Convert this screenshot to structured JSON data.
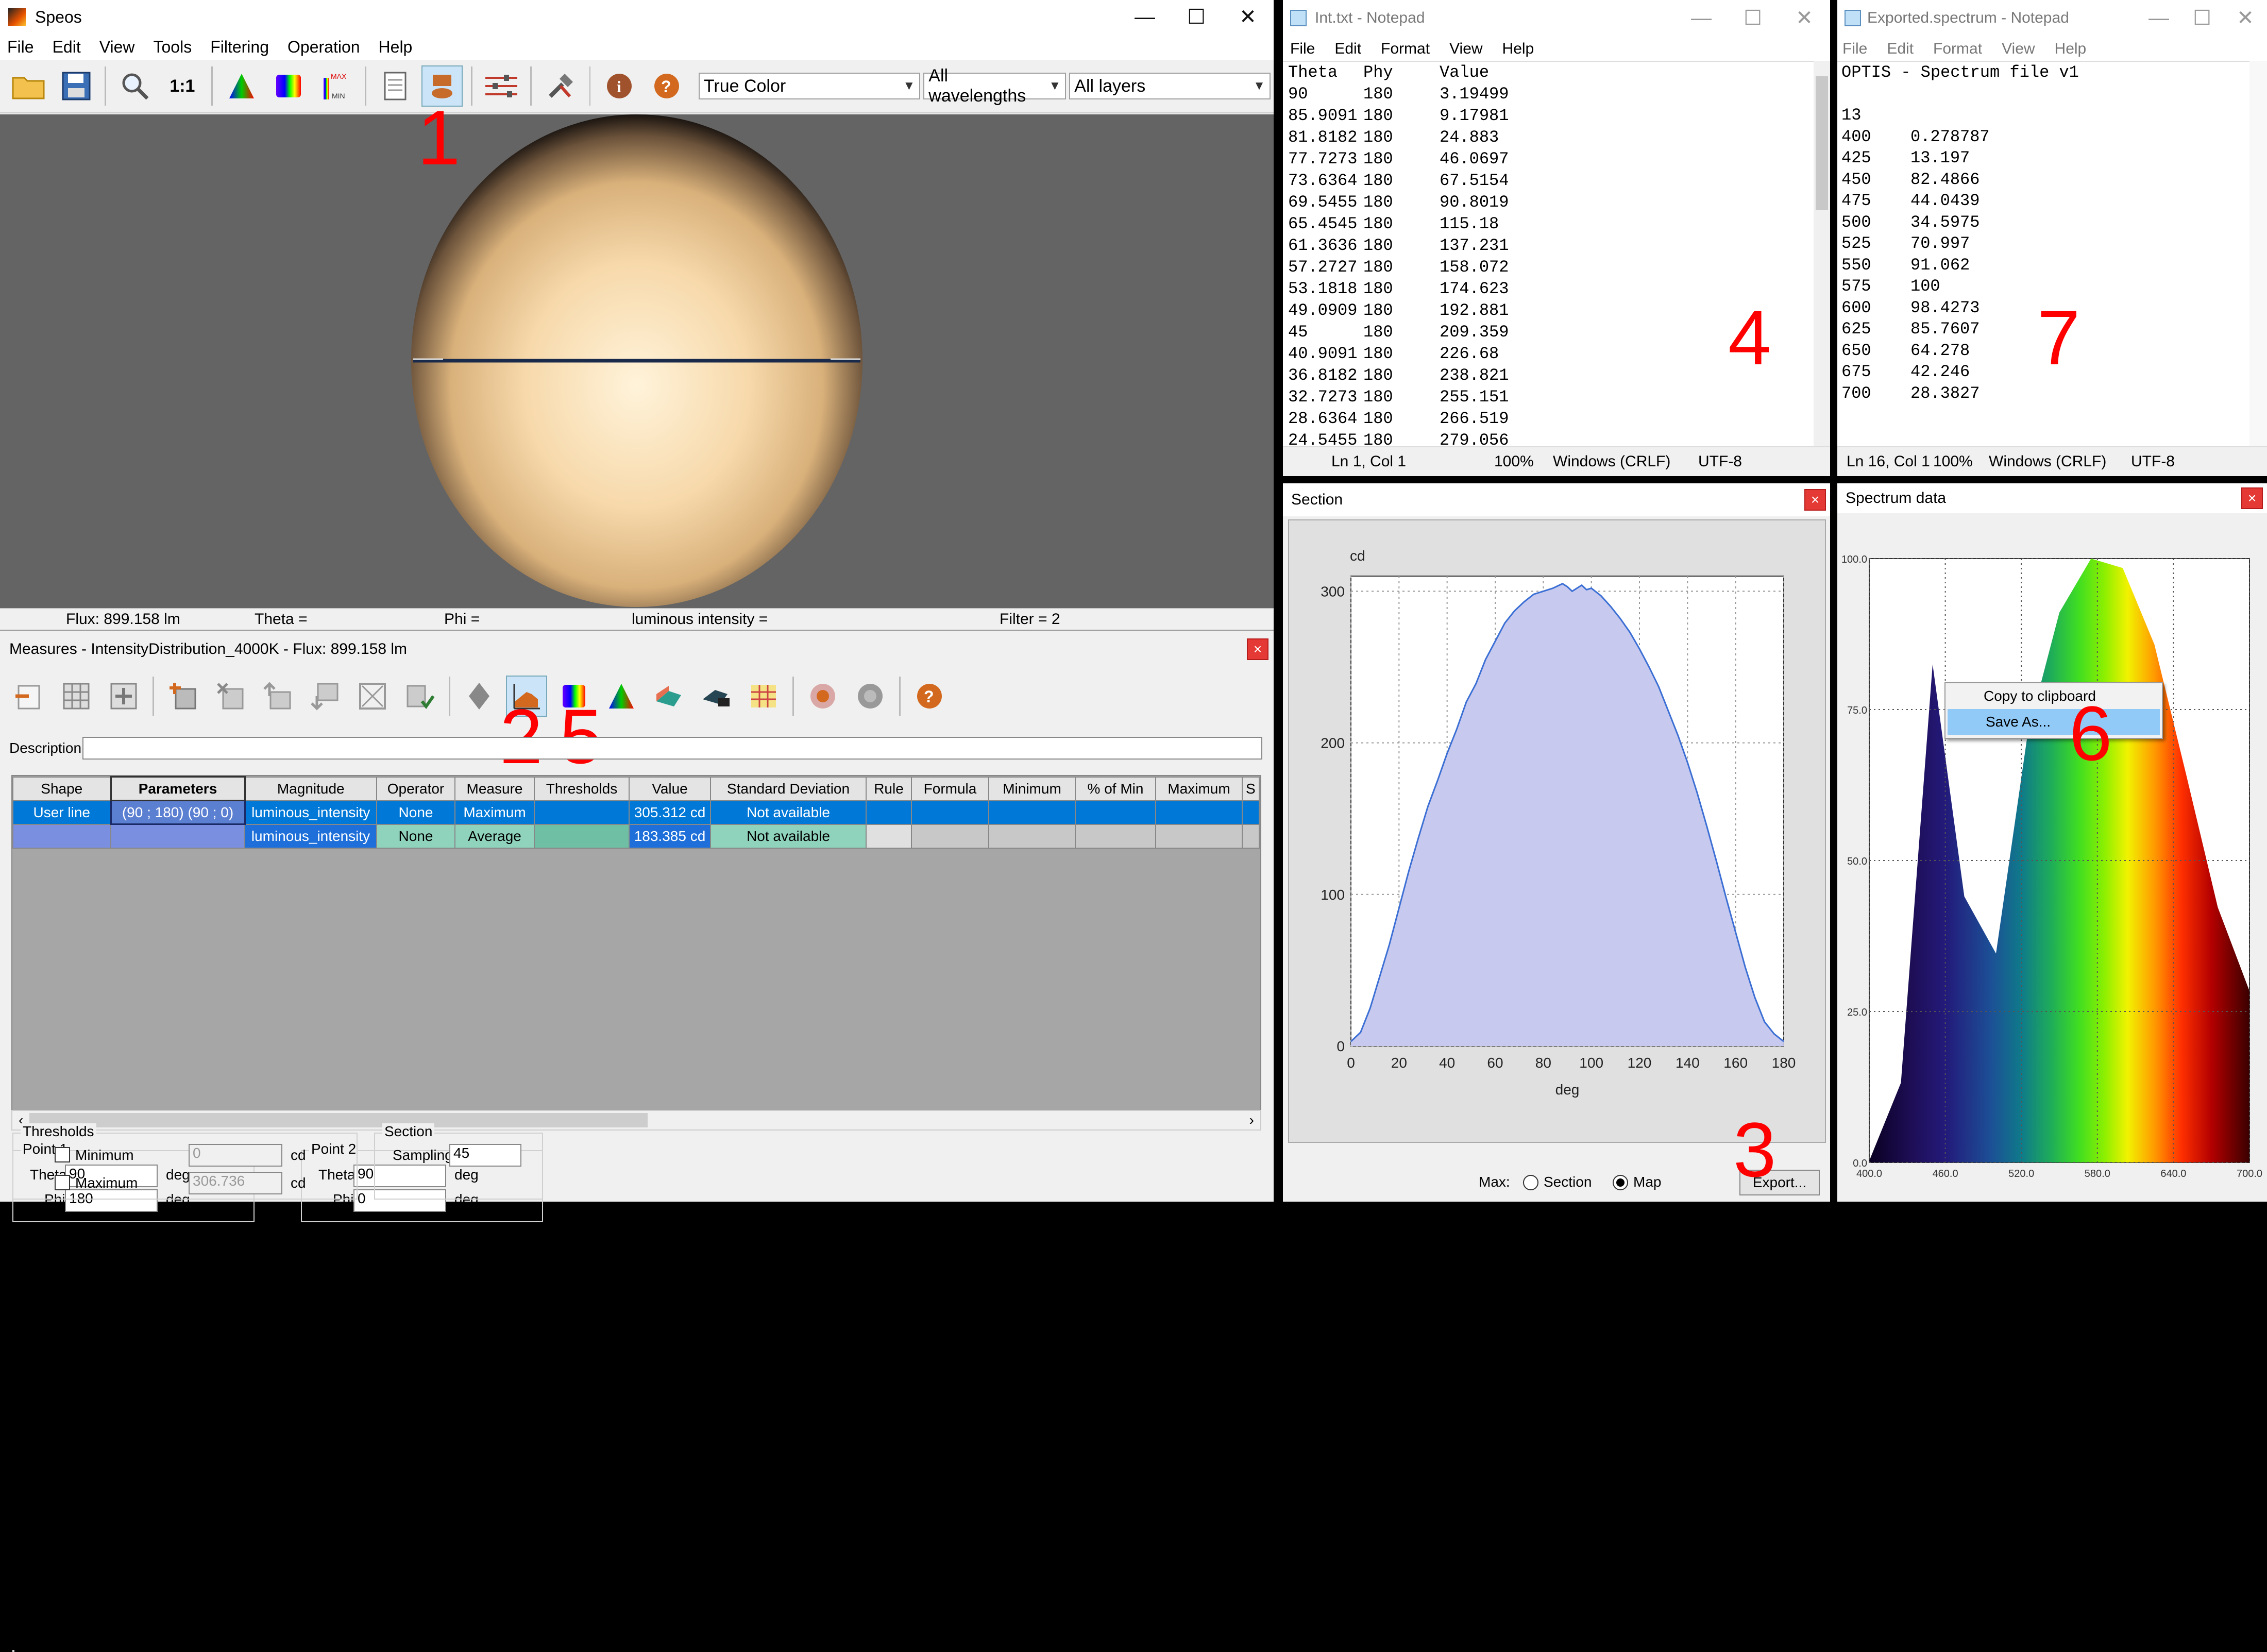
{
  "speos": {
    "title": "Speos",
    "menu": [
      "File",
      "Edit",
      "View",
      "Tools",
      "Filtering",
      "Operation",
      "Help"
    ],
    "toolbar_icons": [
      "open-icon",
      "save-icon",
      "zoom-icon",
      "actual-size-icon",
      "color-chart-icon",
      "spectrum-icon",
      "max-scale-icon",
      "report-icon",
      "section-view-icon",
      "parameters-icon",
      "tools-icon",
      "info-icon",
      "help-icon"
    ],
    "combo_color": "True Color",
    "combo_wavelengths": "All wavelengths",
    "combo_layers": "All layers",
    "status": {
      "flux": "Flux: 899.158 lm",
      "theta": "Theta =",
      "phi": "Phi =",
      "intensity": "luminous intensity =",
      "filter": "Filter = 2"
    }
  },
  "measures": {
    "title": "Measures - IntensityDistribution_4000K - Flux: 899.158 lm",
    "description_label": "Description",
    "columns": [
      "Shape",
      "Parameters",
      "Magnitude",
      "Operator",
      "Measure",
      "Thresholds",
      "Value",
      "Standard Deviation",
      "Rule",
      "Formula",
      "Minimum",
      "% of Min",
      "Maximum",
      "S"
    ],
    "rows": [
      {
        "shape": "User line",
        "params": "(90 ; 180) (90 ; 0)",
        "magnitude": "luminous_intensity",
        "operator": "None",
        "measure": "Maximum",
        "value": "305.312 cd",
        "std": "Not available"
      },
      {
        "shape": "",
        "params": "",
        "magnitude": "luminous_intensity",
        "operator": "None",
        "measure": "Average",
        "value": "183.385 cd",
        "std": "Not available"
      }
    ],
    "point1": {
      "label": "Point 1",
      "theta_label": "Theta",
      "theta": "90",
      "phi_label": "Phi",
      "phi": "180",
      "unit": "deg"
    },
    "point2": {
      "label": "Point 2",
      "theta_label": "Theta",
      "theta": "90",
      "phi_label": "Phi",
      "phi": "0",
      "unit": "deg"
    },
    "thresholds": {
      "label": "Thresholds",
      "min_label": "Minimum",
      "min_value": "0",
      "max_label": "Maximum",
      "max_value": "306.736",
      "unit": "cd"
    },
    "section": {
      "label": "Section",
      "sampling_label": "Sampling",
      "sampling": "45"
    }
  },
  "notepad_int": {
    "title": "Int.txt - Notepad",
    "menu": [
      "File",
      "Edit",
      "Format",
      "View",
      "Help"
    ],
    "header": [
      "Theta",
      "Phy",
      "Value"
    ],
    "lines": [
      [
        "90",
        "180",
        "3.19499"
      ],
      [
        "85.9091",
        "180",
        "9.17981"
      ],
      [
        "81.8182",
        "180",
        "24.883"
      ],
      [
        "77.7273",
        "180",
        "46.0697"
      ],
      [
        "73.6364",
        "180",
        "67.5154"
      ],
      [
        "69.5455",
        "180",
        "90.8019"
      ],
      [
        "65.4545",
        "180",
        "115.18"
      ],
      [
        "61.3636",
        "180",
        "137.231"
      ],
      [
        "57.2727",
        "180",
        "158.072"
      ],
      [
        "53.1818",
        "180",
        "174.623"
      ],
      [
        "49.0909",
        "180",
        "192.881"
      ],
      [
        "45",
        "180",
        "209.359"
      ],
      [
        "40.9091",
        "180",
        "226.68"
      ],
      [
        "36.8182",
        "180",
        "238.821"
      ],
      [
        "32.7273",
        "180",
        "255.151"
      ],
      [
        "28.6364",
        "180",
        "266.519"
      ],
      [
        "24.5455",
        "180",
        "279.056"
      ]
    ],
    "status": {
      "pos": "Ln 1, Col 1",
      "zoom": "100%",
      "eol": "Windows (CRLF)",
      "enc": "UTF-8"
    }
  },
  "notepad_spec": {
    "title": "Exported.spectrum - Notepad",
    "menu": [
      "File",
      "Edit",
      "Format",
      "View",
      "Help"
    ],
    "header": "OPTIS - Spectrum file v1",
    "count": "13",
    "lines": [
      [
        "400",
        "0.278787"
      ],
      [
        "425",
        "13.197"
      ],
      [
        "450",
        "82.4866"
      ],
      [
        "475",
        "44.0439"
      ],
      [
        "500",
        "34.5975"
      ],
      [
        "525",
        "70.997"
      ],
      [
        "550",
        "91.062"
      ],
      [
        "575",
        "100"
      ],
      [
        "600",
        "98.4273"
      ],
      [
        "625",
        "85.7607"
      ],
      [
        "650",
        "64.278"
      ],
      [
        "675",
        "42.246"
      ],
      [
        "700",
        "28.3827"
      ]
    ],
    "status": {
      "pos": "Ln 16, Col 1",
      "zoom": "100%",
      "eol": "Windows (CRLF)",
      "enc": "UTF-8"
    }
  },
  "section_window": {
    "title": "Section",
    "max_label": "Max:",
    "radio_section": "Section",
    "radio_map": "Map",
    "export": "Export..."
  },
  "spectrum_window": {
    "title": "Spectrum data",
    "context_menu": [
      "Copy to clipboard",
      "Save As..."
    ]
  },
  "annotations": {
    "a1": "1",
    "a2": "2",
    "a5": "5",
    "a3": "3",
    "a4": "4",
    "a6": "6",
    "a7": "7"
  },
  "chart_data": [
    {
      "type": "area",
      "title": "",
      "ylabel": "cd",
      "xlabel": "deg",
      "xlim": [
        0,
        180
      ],
      "ylim": [
        0,
        310
      ],
      "xticks": [
        "0",
        "20",
        "40",
        "60",
        "80",
        "100",
        "120",
        "140",
        "160",
        "180"
      ],
      "yticks": [
        "0",
        "100",
        "200",
        "300"
      ],
      "grid": true,
      "x": [
        0,
        4,
        8,
        12,
        16,
        20,
        24,
        28,
        32,
        36,
        40,
        44,
        48,
        52,
        56,
        60,
        64,
        68,
        72,
        76,
        80,
        84,
        88,
        90,
        92,
        94,
        96,
        98,
        100,
        104,
        108,
        112,
        116,
        120,
        124,
        128,
        132,
        136,
        140,
        144,
        148,
        152,
        156,
        160,
        164,
        168,
        172,
        176,
        180
      ],
      "values": [
        3,
        9,
        25,
        46,
        67,
        91,
        115,
        137,
        158,
        175,
        193,
        209,
        227,
        239,
        255,
        267,
        279,
        287,
        293,
        298,
        300,
        302,
        305,
        303,
        300,
        302,
        304,
        301,
        302,
        297,
        290,
        282,
        273,
        262,
        250,
        237,
        221,
        205,
        187,
        167,
        145,
        122,
        98,
        75,
        52,
        32,
        16,
        8,
        3
      ]
    },
    {
      "type": "area",
      "title": "",
      "xlim": [
        400,
        700
      ],
      "ylim": [
        0,
        100
      ],
      "xticks": [
        "400.0",
        "460.0",
        "520.0",
        "580.0",
        "640.0",
        "700.0"
      ],
      "yticks": [
        "0.0",
        "25.0",
        "50.0",
        "75.0",
        "100.0"
      ],
      "grid": true,
      "x": [
        400,
        425,
        450,
        475,
        500,
        525,
        550,
        575,
        600,
        625,
        650,
        675,
        700
      ],
      "values": [
        0.278787,
        13.197,
        82.4866,
        44.0439,
        34.5975,
        70.997,
        91.062,
        100,
        98.4273,
        85.7607,
        64.278,
        42.246,
        28.3827
      ]
    }
  ]
}
